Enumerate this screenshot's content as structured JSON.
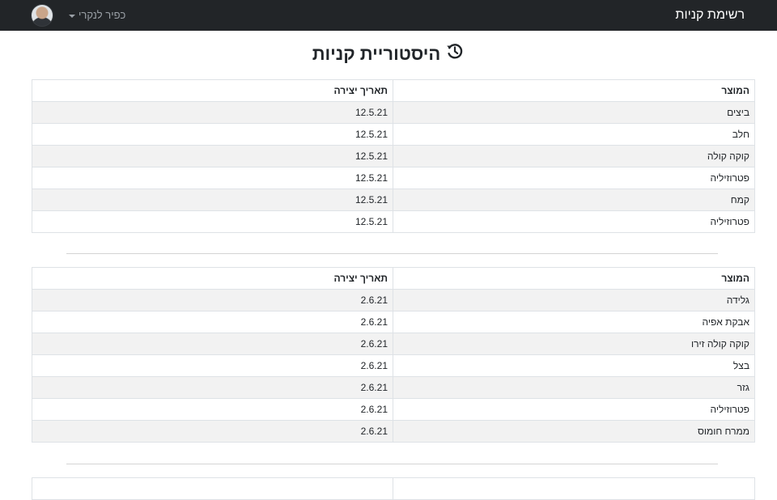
{
  "navbar": {
    "brand": "רשימת קניות",
    "user_name": "כפיר לנקרי",
    "avatar_icon": "user-avatar"
  },
  "page": {
    "title": "היסטוריית קניות",
    "title_icon": "history-icon"
  },
  "tables": [
    {
      "headers": [
        "המוצר",
        "תאריך יצירה"
      ],
      "rows": [
        [
          "ביצים",
          "12.5.21"
        ],
        [
          "חלב",
          "12.5.21"
        ],
        [
          "קוקה קולה",
          "12.5.21"
        ],
        [
          "פטרוזיליה",
          "12.5.21"
        ],
        [
          "קמח",
          "12.5.21"
        ],
        [
          "פטרוזיליה",
          "12.5.21"
        ]
      ]
    },
    {
      "headers": [
        "המוצר",
        "תאריך יצירה"
      ],
      "rows": [
        [
          "גלידה",
          "2.6.21"
        ],
        [
          "אבקת אפיה",
          "2.6.21"
        ],
        [
          "קוקה קולה זירו",
          "2.6.21"
        ],
        [
          "בצל",
          "2.6.21"
        ],
        [
          "גזר",
          "2.6.21"
        ],
        [
          "פטרוזיליה",
          "2.6.21"
        ],
        [
          "ממרח חומוס",
          "2.6.21"
        ]
      ]
    },
    {
      "headers": [
        "",
        ""
      ],
      "rows": []
    }
  ]
}
